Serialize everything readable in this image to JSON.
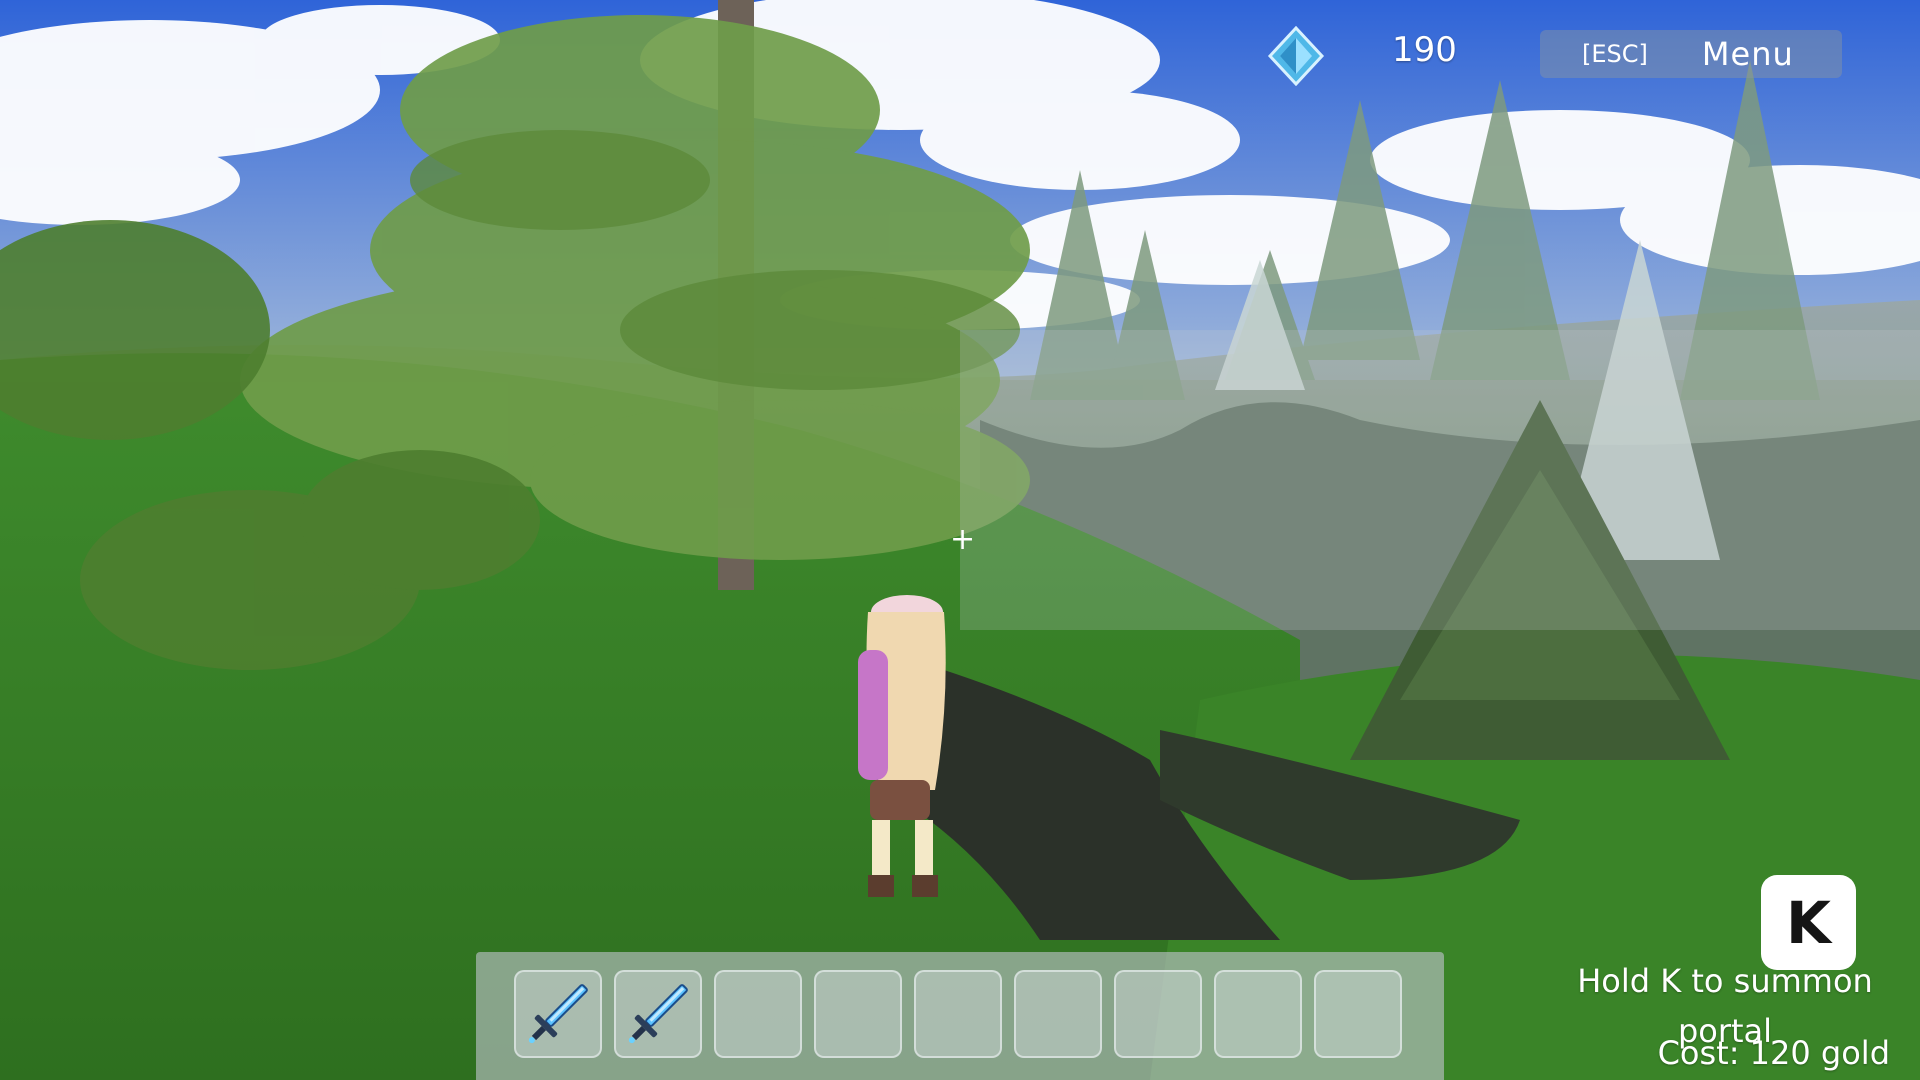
{
  "hud": {
    "currency_icon": "diamond-gem-icon",
    "currency_amount": "190",
    "menu_key": "[ESC]",
    "menu_label": "Menu"
  },
  "crosshair": "+",
  "hotbar": {
    "slots": [
      {
        "item": "blue-sword-icon"
      },
      {
        "item": "blue-sword-icon"
      },
      {
        "item": null
      },
      {
        "item": null
      },
      {
        "item": null
      },
      {
        "item": null
      },
      {
        "item": null
      },
      {
        "item": null
      },
      {
        "item": null
      }
    ]
  },
  "portal": {
    "key": "K",
    "hint": "Hold K to summon portal",
    "cost": "Cost: 120 gold"
  },
  "colors": {
    "sky": "#3b6fd6",
    "grass": "#3f8a2a",
    "hud_text": "#ffffff",
    "gem": "#4fb8e8"
  }
}
